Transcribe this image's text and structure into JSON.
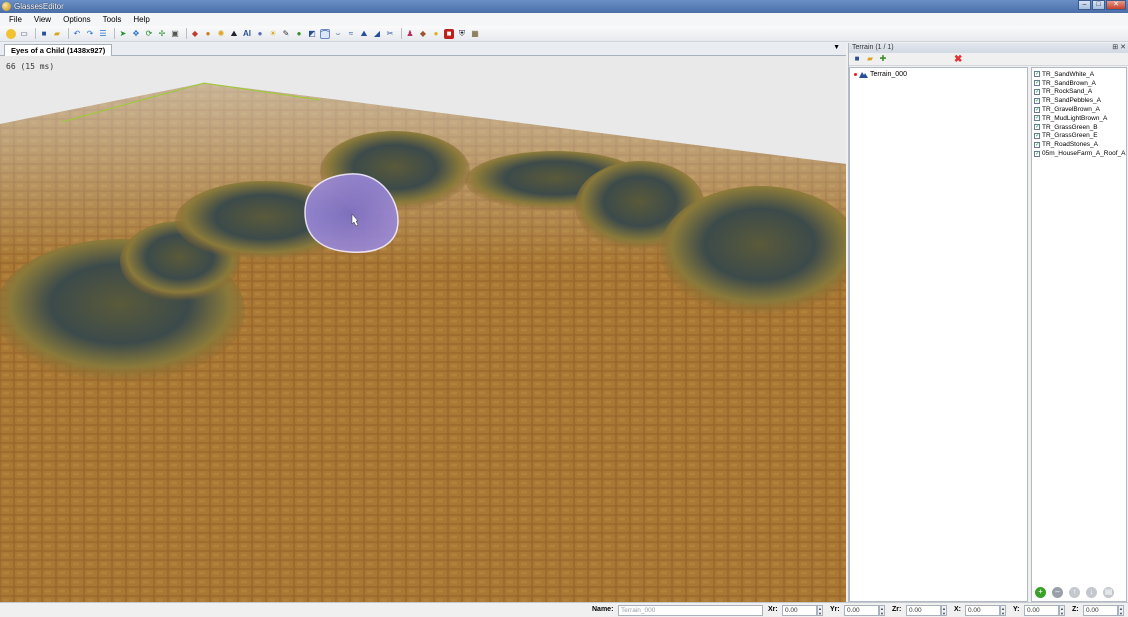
{
  "window": {
    "title": "GlassesEditor"
  },
  "menu": [
    "File",
    "View",
    "Options",
    "Tools",
    "Help"
  ],
  "document_tab": {
    "label": "Eyes of a Child (1438x927)"
  },
  "viewport": {
    "fps_text": "66 (15 ms)"
  },
  "panel": {
    "title": "Terrain (1 / 1)",
    "tree": [
      {
        "label": "Terrain_000"
      }
    ],
    "layers": [
      {
        "label": "TR_SandWhite_A",
        "checked": true
      },
      {
        "label": "TR_SandBrown_A",
        "checked": true
      },
      {
        "label": "TR_RockSand_A",
        "checked": true
      },
      {
        "label": "TR_SandPebbles_A",
        "checked": true
      },
      {
        "label": "TR_GravelBrown_A",
        "checked": true
      },
      {
        "label": "TR_MudLightBrown_A",
        "checked": true
      },
      {
        "label": "TR_GrassGreen_B",
        "checked": true
      },
      {
        "label": "TR_GrassGreen_E",
        "checked": true
      },
      {
        "label": "TR_RoadStones_A",
        "checked": true
      },
      {
        "label": "05m_HouseFarm_A_Roof_A",
        "checked": true
      }
    ]
  },
  "statusbar": {
    "name_label": "Name:",
    "name_value": "Terrain_000",
    "fields": [
      {
        "label": "Xr:",
        "value": "0.00"
      },
      {
        "label": "Yr:",
        "value": "0.00"
      },
      {
        "label": "Zr:",
        "value": "0.00"
      },
      {
        "label": "X:",
        "value": "0.00"
      },
      {
        "label": "Y:",
        "value": "0.00"
      },
      {
        "label": "Z:",
        "value": "0.00"
      }
    ]
  },
  "icons": {
    "toolbar": [
      "open-icon",
      "save-icon",
      "undo-icon",
      "redo-icon",
      "select-icon",
      "move-icon",
      "rotate-icon",
      "terrain-icon",
      "brush-icon",
      "light-icon",
      "settings-icon"
    ],
    "panel_toolbar": [
      "save-icon",
      "open-folder-icon",
      "add-icon",
      "delete-icon"
    ],
    "layer_actions": [
      "add-layer-icon",
      "remove-layer-icon",
      "move-up-icon",
      "move-down-icon",
      "properties-icon"
    ]
  },
  "colors": {
    "brush": "#8a7ad0",
    "ground": "#9c6a2c",
    "titlebar": "#5a80bb"
  }
}
